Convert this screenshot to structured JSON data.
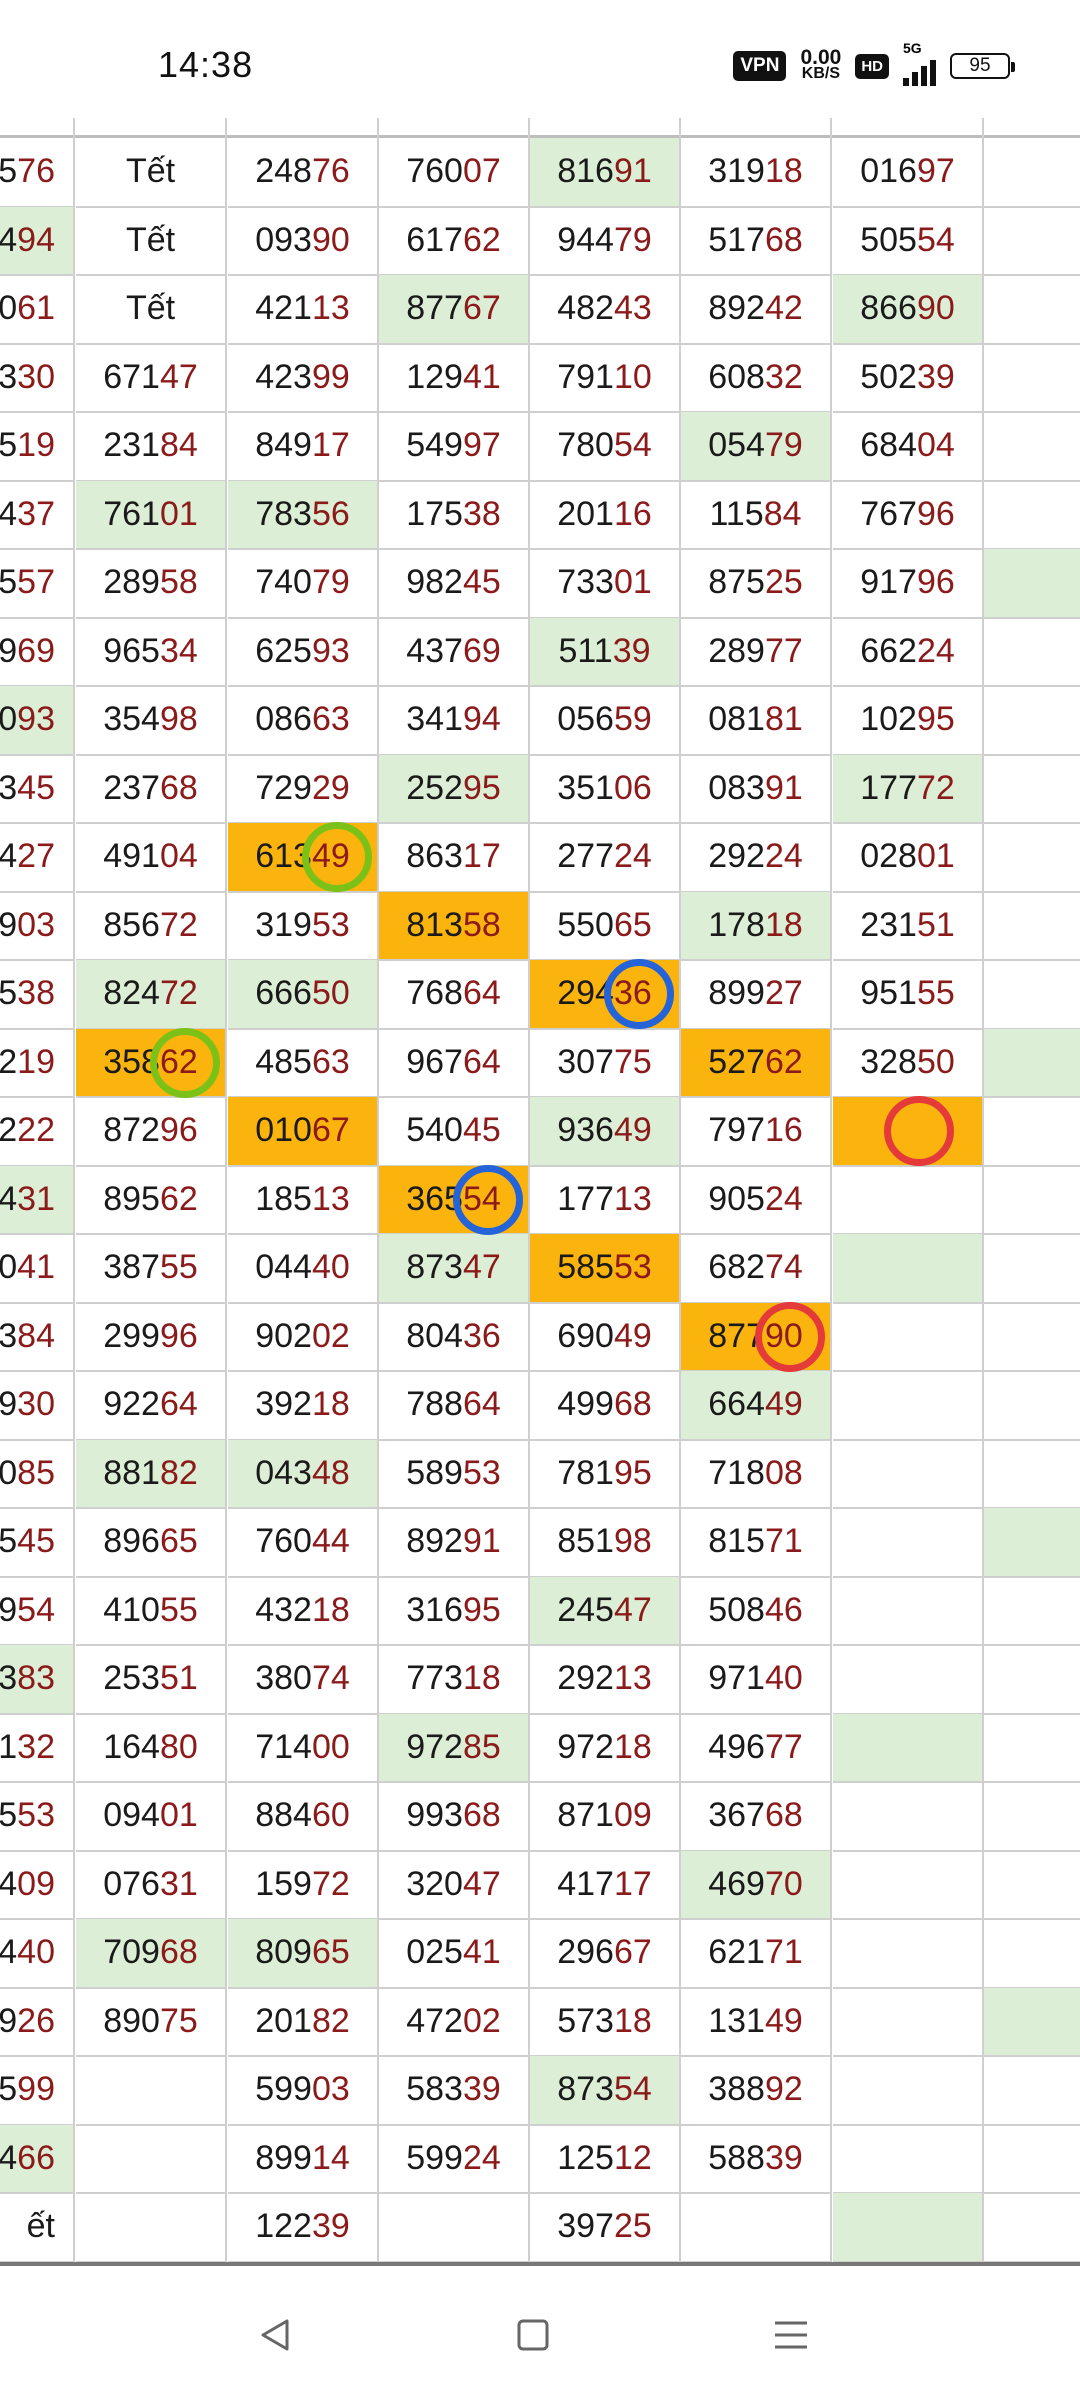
{
  "status_bar": {
    "time": "14:38",
    "vpn": "VPN",
    "speed_value": "0.00",
    "speed_unit": "KB/S",
    "hd": "HD",
    "network": "5G",
    "battery": "95",
    "icons": [
      "vpn-icon",
      "hd-icon",
      "signal-icon",
      "battery-icon"
    ]
  },
  "table": {
    "columns": [
      {
        "index": 0,
        "label": "col-0"
      },
      {
        "index": 1,
        "label": "col-1"
      },
      {
        "index": 2,
        "label": "col-2"
      },
      {
        "index": 3,
        "label": "col-3"
      },
      {
        "index": 4,
        "label": "col-4"
      },
      {
        "index": 5,
        "label": "col-5"
      },
      {
        "index": 6,
        "label": "col-6"
      },
      {
        "index": 7,
        "label": "col-7"
      }
    ],
    "rows": [
      [
        [
          "576",
          "",
          ""
        ],
        [
          "Tết",
          "",
          ""
        ],
        [
          "24876",
          "",
          ""
        ],
        [
          "76007",
          "",
          ""
        ],
        [
          "81691",
          "g",
          ""
        ],
        [
          "31918",
          "",
          ""
        ],
        [
          "01697",
          "",
          ""
        ],
        [
          "",
          "",
          ""
        ]
      ],
      [
        [
          "494",
          "g",
          ""
        ],
        [
          "Tết",
          "",
          ""
        ],
        [
          "09390",
          "",
          ""
        ],
        [
          "61762",
          "",
          ""
        ],
        [
          "94479",
          "",
          ""
        ],
        [
          "51768",
          "",
          ""
        ],
        [
          "50554",
          "",
          ""
        ],
        [
          "",
          "",
          ""
        ]
      ],
      [
        [
          "061",
          "",
          ""
        ],
        [
          "Tết",
          "",
          ""
        ],
        [
          "42113",
          "",
          ""
        ],
        [
          "87767",
          "g",
          ""
        ],
        [
          "48243",
          "",
          ""
        ],
        [
          "89242",
          "",
          ""
        ],
        [
          "86690",
          "g",
          ""
        ],
        [
          "",
          "",
          ""
        ]
      ],
      [
        [
          "330",
          "",
          ""
        ],
        [
          "67147",
          "",
          ""
        ],
        [
          "42399",
          "",
          ""
        ],
        [
          "12941",
          "",
          ""
        ],
        [
          "79110",
          "",
          ""
        ],
        [
          "60832",
          "",
          ""
        ],
        [
          "50239",
          "",
          ""
        ],
        [
          "",
          "",
          ""
        ]
      ],
      [
        [
          "519",
          "",
          ""
        ],
        [
          "23184",
          "",
          ""
        ],
        [
          "84917",
          "",
          ""
        ],
        [
          "54997",
          "",
          ""
        ],
        [
          "78054",
          "",
          ""
        ],
        [
          "05479",
          "g",
          ""
        ],
        [
          "68404",
          "",
          ""
        ],
        [
          "",
          "",
          ""
        ]
      ],
      [
        [
          "437",
          "",
          ""
        ],
        [
          "76101",
          "g",
          ""
        ],
        [
          "78356",
          "g",
          ""
        ],
        [
          "17538",
          "",
          ""
        ],
        [
          "20116",
          "",
          ""
        ],
        [
          "11584",
          "",
          ""
        ],
        [
          "76796",
          "",
          ""
        ],
        [
          "",
          "",
          ""
        ]
      ],
      [
        [
          "557",
          "",
          ""
        ],
        [
          "28958",
          "",
          ""
        ],
        [
          "74079",
          "",
          ""
        ],
        [
          "98245",
          "",
          ""
        ],
        [
          "73301",
          "",
          ""
        ],
        [
          "87525",
          "",
          ""
        ],
        [
          "91796",
          "",
          ""
        ],
        [
          "",
          "g",
          ""
        ]
      ],
      [
        [
          "969",
          "",
          ""
        ],
        [
          "96534",
          "",
          ""
        ],
        [
          "62593",
          "",
          ""
        ],
        [
          "43769",
          "",
          ""
        ],
        [
          "51139",
          "g",
          ""
        ],
        [
          "28977",
          "",
          ""
        ],
        [
          "66224",
          "",
          ""
        ],
        [
          "",
          "",
          ""
        ]
      ],
      [
        [
          "093",
          "g",
          ""
        ],
        [
          "35498",
          "",
          ""
        ],
        [
          "08663",
          "",
          ""
        ],
        [
          "34194",
          "",
          ""
        ],
        [
          "05659",
          "",
          ""
        ],
        [
          "08181",
          "",
          ""
        ],
        [
          "10295",
          "",
          ""
        ],
        [
          "",
          "",
          ""
        ]
      ],
      [
        [
          "345",
          "",
          ""
        ],
        [
          "23768",
          "",
          ""
        ],
        [
          "72929",
          "",
          ""
        ],
        [
          "25295",
          "g",
          ""
        ],
        [
          "35106",
          "",
          ""
        ],
        [
          "08391",
          "",
          ""
        ],
        [
          "17772",
          "g",
          ""
        ],
        [
          "",
          "",
          ""
        ]
      ],
      [
        [
          "427",
          "",
          ""
        ],
        [
          "49104",
          "",
          ""
        ],
        [
          "61349",
          "o",
          "green"
        ],
        [
          "86317",
          "",
          ""
        ],
        [
          "27724",
          "",
          ""
        ],
        [
          "29224",
          "",
          ""
        ],
        [
          "02801",
          "",
          ""
        ],
        [
          "",
          "",
          ""
        ]
      ],
      [
        [
          "903",
          "",
          ""
        ],
        [
          "85672",
          "",
          ""
        ],
        [
          "31953",
          "",
          ""
        ],
        [
          "81358",
          "o",
          ""
        ],
        [
          "55065",
          "",
          ""
        ],
        [
          "17818",
          "g",
          ""
        ],
        [
          "23151",
          "",
          ""
        ],
        [
          "",
          "",
          ""
        ]
      ],
      [
        [
          "538",
          "",
          ""
        ],
        [
          "82472",
          "g",
          ""
        ],
        [
          "66650",
          "g",
          ""
        ],
        [
          "76864",
          "",
          ""
        ],
        [
          "29436",
          "o",
          "blue"
        ],
        [
          "89927",
          "",
          ""
        ],
        [
          "95155",
          "",
          ""
        ],
        [
          "",
          "",
          ""
        ]
      ],
      [
        [
          "219",
          "",
          ""
        ],
        [
          "35862",
          "o",
          "green"
        ],
        [
          "48563",
          "",
          ""
        ],
        [
          "96764",
          "",
          ""
        ],
        [
          "30775",
          "",
          ""
        ],
        [
          "52762",
          "o",
          ""
        ],
        [
          "32850",
          "",
          ""
        ],
        [
          "",
          "g",
          ""
        ]
      ],
      [
        [
          "222",
          "",
          ""
        ],
        [
          "87296",
          "",
          ""
        ],
        [
          "01067",
          "o",
          ""
        ],
        [
          "54045",
          "",
          ""
        ],
        [
          "93649",
          "g",
          ""
        ],
        [
          "79716",
          "",
          ""
        ],
        [
          "",
          "o",
          "red"
        ],
        [
          "",
          "",
          ""
        ]
      ],
      [
        [
          "431",
          "g",
          ""
        ],
        [
          "89562",
          "",
          ""
        ],
        [
          "18513",
          "",
          ""
        ],
        [
          "36554",
          "o",
          "blue"
        ],
        [
          "17713",
          "",
          ""
        ],
        [
          "90524",
          "",
          ""
        ],
        [
          "",
          "",
          ""
        ],
        [
          "",
          "",
          ""
        ]
      ],
      [
        [
          "041",
          "",
          ""
        ],
        [
          "38755",
          "",
          ""
        ],
        [
          "04440",
          "",
          ""
        ],
        [
          "87347",
          "g",
          ""
        ],
        [
          "58553",
          "o",
          ""
        ],
        [
          "68274",
          "",
          ""
        ],
        [
          "",
          "g",
          ""
        ],
        [
          "",
          "",
          ""
        ]
      ],
      [
        [
          "384",
          "",
          ""
        ],
        [
          "29996",
          "",
          ""
        ],
        [
          "90202",
          "",
          ""
        ],
        [
          "80436",
          "",
          ""
        ],
        [
          "69049",
          "",
          ""
        ],
        [
          "87790",
          "o",
          "red"
        ],
        [
          "",
          "",
          ""
        ],
        [
          "",
          "",
          ""
        ]
      ],
      [
        [
          "930",
          "",
          ""
        ],
        [
          "92264",
          "",
          ""
        ],
        [
          "39218",
          "",
          ""
        ],
        [
          "78864",
          "",
          ""
        ],
        [
          "49968",
          "",
          ""
        ],
        [
          "66449",
          "g",
          ""
        ],
        [
          "",
          "",
          ""
        ],
        [
          "",
          "",
          ""
        ]
      ],
      [
        [
          "085",
          "",
          ""
        ],
        [
          "88182",
          "g",
          ""
        ],
        [
          "04348",
          "g",
          ""
        ],
        [
          "58953",
          "",
          ""
        ],
        [
          "78195",
          "",
          ""
        ],
        [
          "71808",
          "",
          ""
        ],
        [
          "",
          "",
          ""
        ],
        [
          "",
          "",
          ""
        ]
      ],
      [
        [
          "545",
          "",
          ""
        ],
        [
          "89665",
          "",
          ""
        ],
        [
          "76044",
          "",
          ""
        ],
        [
          "89291",
          "",
          ""
        ],
        [
          "85198",
          "",
          ""
        ],
        [
          "81571",
          "",
          ""
        ],
        [
          "",
          "",
          ""
        ],
        [
          "",
          "g",
          ""
        ]
      ],
      [
        [
          "954",
          "",
          ""
        ],
        [
          "41055",
          "",
          ""
        ],
        [
          "43218",
          "",
          ""
        ],
        [
          "31695",
          "",
          ""
        ],
        [
          "24547",
          "g",
          ""
        ],
        [
          "50846",
          "",
          ""
        ],
        [
          "",
          "",
          ""
        ],
        [
          "",
          "",
          ""
        ]
      ],
      [
        [
          "383",
          "g",
          ""
        ],
        [
          "25351",
          "",
          ""
        ],
        [
          "38074",
          "",
          ""
        ],
        [
          "77318",
          "",
          ""
        ],
        [
          "29213",
          "",
          ""
        ],
        [
          "97140",
          "",
          ""
        ],
        [
          "",
          "",
          ""
        ],
        [
          "",
          "",
          ""
        ]
      ],
      [
        [
          "132",
          "",
          ""
        ],
        [
          "16480",
          "",
          ""
        ],
        [
          "71400",
          "",
          ""
        ],
        [
          "97285",
          "g",
          ""
        ],
        [
          "97218",
          "",
          ""
        ],
        [
          "49677",
          "",
          ""
        ],
        [
          "",
          "g",
          ""
        ],
        [
          "",
          "",
          ""
        ]
      ],
      [
        [
          "553",
          "",
          ""
        ],
        [
          "09401",
          "",
          ""
        ],
        [
          "88460",
          "",
          ""
        ],
        [
          "99368",
          "",
          ""
        ],
        [
          "87109",
          "",
          ""
        ],
        [
          "36768",
          "",
          ""
        ],
        [
          "",
          "",
          ""
        ],
        [
          "",
          "",
          ""
        ]
      ],
      [
        [
          "409",
          "",
          ""
        ],
        [
          "07631",
          "",
          ""
        ],
        [
          "15972",
          "",
          ""
        ],
        [
          "32047",
          "",
          ""
        ],
        [
          "41717",
          "",
          ""
        ],
        [
          "46970",
          "g",
          ""
        ],
        [
          "",
          "",
          ""
        ],
        [
          "",
          "",
          ""
        ]
      ],
      [
        [
          "440",
          "",
          ""
        ],
        [
          "70968",
          "g",
          ""
        ],
        [
          "80965",
          "g",
          ""
        ],
        [
          "02541",
          "",
          ""
        ],
        [
          "29667",
          "",
          ""
        ],
        [
          "62171",
          "",
          ""
        ],
        [
          "",
          "",
          ""
        ],
        [
          "",
          "",
          ""
        ]
      ],
      [
        [
          "926",
          "",
          ""
        ],
        [
          "89075",
          "",
          ""
        ],
        [
          "20182",
          "",
          ""
        ],
        [
          "47202",
          "",
          ""
        ],
        [
          "57318",
          "",
          ""
        ],
        [
          "13149",
          "",
          ""
        ],
        [
          "",
          "",
          ""
        ],
        [
          "",
          "g",
          ""
        ]
      ],
      [
        [
          "599",
          "",
          ""
        ],
        [
          "",
          "",
          ""
        ],
        [
          "59903",
          "",
          ""
        ],
        [
          "58339",
          "",
          ""
        ],
        [
          "87354",
          "g",
          ""
        ],
        [
          "38892",
          "",
          ""
        ],
        [
          "",
          "",
          ""
        ],
        [
          "",
          "",
          ""
        ]
      ],
      [
        [
          "466",
          "g",
          ""
        ],
        [
          "",
          "",
          ""
        ],
        [
          "89914",
          "",
          ""
        ],
        [
          "59924",
          "",
          ""
        ],
        [
          "12512",
          "",
          ""
        ],
        [
          "58839",
          "",
          ""
        ],
        [
          "",
          "",
          ""
        ],
        [
          "",
          "",
          ""
        ]
      ],
      [
        [
          "ết",
          "",
          ""
        ],
        [
          "",
          "",
          ""
        ],
        [
          "12239",
          "",
          ""
        ],
        [
          "",
          "",
          ""
        ],
        [
          "39725",
          "",
          ""
        ],
        [
          "",
          "",
          ""
        ],
        [
          "",
          "g",
          ""
        ],
        [
          "",
          "",
          ""
        ]
      ]
    ]
  },
  "colors": {
    "highlight_green": "#dcefd6",
    "highlight_orange": "#fbb40d",
    "digit_accent": "#8b1a1a",
    "ring_green": "#7cc118",
    "ring_blue": "#2563d9",
    "ring_red": "#e53a3a"
  },
  "nav": {
    "icons": [
      "back-icon",
      "home-icon",
      "menu-icon"
    ]
  }
}
